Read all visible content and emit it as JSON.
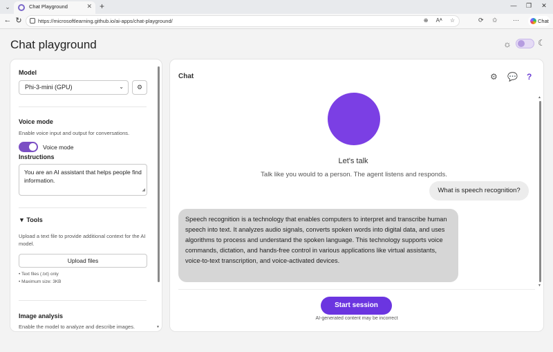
{
  "browser": {
    "tab_title": "Chat Playground",
    "tab_close": "✕",
    "new_tab": "+",
    "url": "https://microsoftlearning.github.io/ai-apps/chat-playground/",
    "copilot_label": "Chat",
    "window_controls": [
      "—",
      "❐",
      "✕"
    ],
    "url_action_icons": [
      "⊕",
      "Aᴬ",
      "☆"
    ],
    "toolbar_icons": [
      "⟳",
      "✩"
    ]
  },
  "page": {
    "title": "Chat playground"
  },
  "theme": {
    "sun": "☼",
    "moon": "☾"
  },
  "left": {
    "model_label": "Model",
    "model_value": "Phi-3-mini (GPU)",
    "voice_mode_label": "Voice mode",
    "voice_mode_desc": "Enable voice input and output for conversations.",
    "voice_toggle_label": "Voice mode",
    "voice_mode_on": true,
    "instructions_label": "Instructions",
    "instructions_value": "You are an AI assistant that helps people find information.",
    "tools_label": "▼ Tools",
    "tools_desc": "Upload a text file to provide additional context for the AI model.",
    "upload_button": "Upload files",
    "file_note_1": "• Text files (.txt) only",
    "file_note_2": "• Maximum size: 3KB",
    "image_analysis_label": "Image analysis",
    "image_analysis_desc": "Enable the model to analyze and describe images."
  },
  "chat": {
    "title": "Chat",
    "lets_talk": "Let's talk",
    "subtitle": "Talk like you would to a person. The agent listens and responds.",
    "user_message": "What is speech recognition?",
    "assistant_message": "Speech recognition is a technology that enables computers to interpret and transcribe human speech into text. It analyzes audio signals, converts spoken words into digital data, and uses algorithms to process and understand the spoken language. This technology supports voice commands, dictation, and hands-free control in various applications like virtual assistants, voice-to-text transcription, and voice-activated devices.",
    "start_button": "Start session",
    "disclaimer": "AI-generated content may be incorrect",
    "help_icon": "?"
  },
  "colors": {
    "accent": "#6b35e0",
    "orb": "#7b3fe4",
    "toggle_on": "#7b4fc4"
  }
}
